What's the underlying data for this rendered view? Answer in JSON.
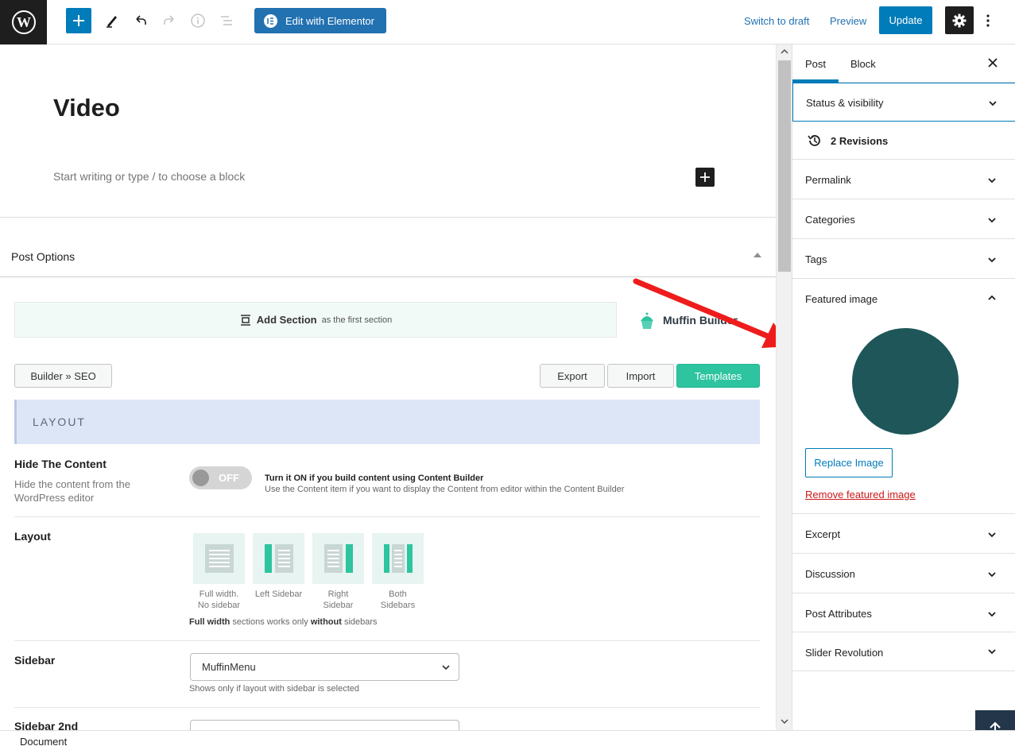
{
  "toolbar": {
    "elementor_label": "Edit with Elementor",
    "switch_draft_label": "Switch to draft",
    "preview_label": "Preview",
    "update_label": "Update"
  },
  "editor": {
    "post_title": "Video",
    "block_placeholder": "Start writing or type / to choose a block"
  },
  "post_options": {
    "title": "Post Options",
    "add_section_label": "Add Section",
    "add_section_sub": "as the first section",
    "brand": "Muffin Builder",
    "builder_seo_label": "Builder » SEO",
    "export_label": "Export",
    "import_label": "Import",
    "templates_label": "Templates",
    "layout_heading": "LAYOUT",
    "hide_content": {
      "label": "Hide The Content",
      "desc": "Hide the content from the WordPress editor",
      "toggle_state": "OFF",
      "note_bold": "Turn it ON if you build content using Content Builder",
      "note": "Use the Content item if you want to display the Content from editor within the Content Builder"
    },
    "layout": {
      "label": "Layout",
      "options": [
        {
          "line1": "Full width.",
          "line2": "No sidebar"
        },
        {
          "line1": "Left Sidebar",
          "line2": ""
        },
        {
          "line1": "Right",
          "line2": "Sidebar"
        },
        {
          "line1": "Both",
          "line2": "Sidebars"
        }
      ],
      "note_b1": "Full width",
      "note_mid": " sections works only ",
      "note_b2": "without",
      "note_end": " sidebars"
    },
    "sidebar": {
      "label": "Sidebar",
      "selected": "MuffinMenu",
      "note": "Shows only if layout with sidebar is selected"
    },
    "sidebar2": {
      "label": "Sidebar 2nd"
    }
  },
  "sidebar": {
    "tabs": [
      "Post",
      "Block"
    ],
    "panels": {
      "status": "Status & visibility",
      "revisions": "2 Revisions",
      "permalink": "Permalink",
      "categories": "Categories",
      "tags": "Tags",
      "featured": "Featured image",
      "replace_image": "Replace Image",
      "remove_image": "Remove featured image",
      "excerpt": "Excerpt",
      "discussion": "Discussion",
      "post_attributes": "Post Attributes",
      "slider_revolution": "Slider Revolution"
    }
  },
  "footer": {
    "breadcrumb": "Document"
  },
  "colors": {
    "wp_blue": "#007cba",
    "elementor_blue": "#2271b1",
    "templates_green": "#2ec4a0",
    "featured_image": "#1e5659",
    "annotation_arrow": "#ee1c1c",
    "remove_red": "#cc1818"
  }
}
